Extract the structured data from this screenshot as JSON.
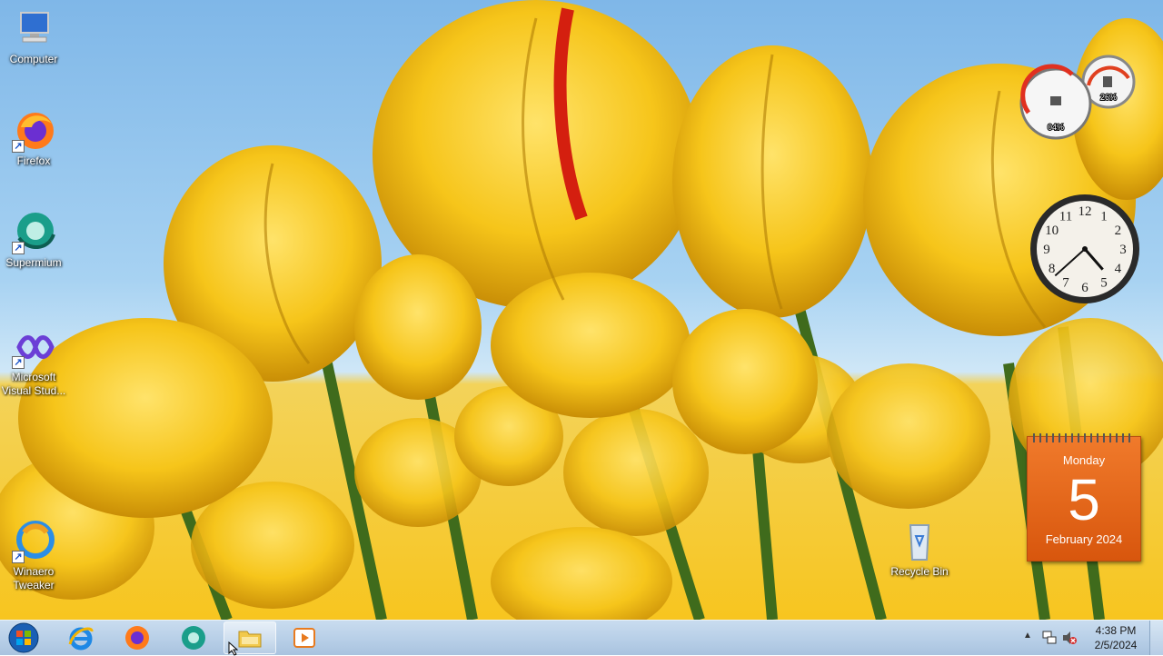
{
  "desktop_icons": [
    {
      "label": "Computer",
      "icon": "computer-icon"
    },
    {
      "label": "Firefox",
      "icon": "firefox-icon"
    },
    {
      "label": "Supermium",
      "icon": "supermium-icon"
    },
    {
      "label": "Microsoft Visual Stud...",
      "icon": "visual-studio-icon"
    },
    {
      "label": "Winaero Tweaker",
      "icon": "winaero-tweaker-icon"
    }
  ],
  "recycle_bin": {
    "label": "Recycle Bin",
    "icon": "recycle-bin-icon"
  },
  "gadgets": {
    "cpu_meter": {
      "cpu": "04%",
      "memory": "26%"
    },
    "clock": {
      "hour": 4,
      "minute": 38
    },
    "calendar": {
      "day_name": "Monday",
      "day": "5",
      "month_year": "February 2024"
    }
  },
  "taskbar": {
    "start": {
      "icon": "windows-start-icon"
    },
    "pinned": [
      {
        "name": "internet-explorer",
        "icon": "internet-explorer-icon"
      },
      {
        "name": "firefox",
        "icon": "firefox-icon"
      },
      {
        "name": "supermium",
        "icon": "supermium-icon"
      },
      {
        "name": "file-explorer",
        "icon": "folder-icon",
        "active": true
      },
      {
        "name": "media-player",
        "icon": "media-player-icon"
      }
    ],
    "tray": {
      "time": "4:38 PM",
      "date": "2/5/2024",
      "icons": [
        "show-hidden-icons-arrow",
        "network-icon",
        "volume-muted-icon"
      ]
    }
  },
  "colors": {
    "accent": "#1c56c9",
    "calendar": "#e8661c"
  }
}
